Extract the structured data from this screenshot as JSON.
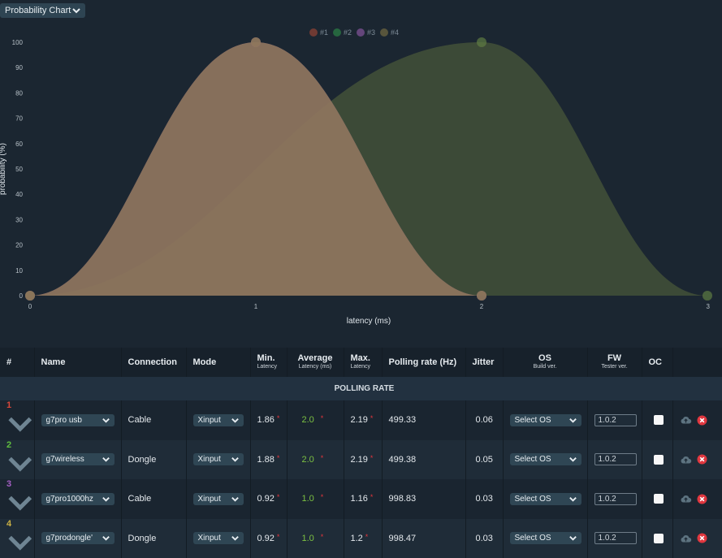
{
  "chart_selector": {
    "label": "Probability Chart",
    "icon": "chevron-down-icon"
  },
  "chart_data": {
    "type": "area",
    "legend": [
      "#1",
      "#2",
      "#3",
      "#4"
    ],
    "legend_position": "top-center",
    "series": [
      {
        "name": "#1",
        "color": "#b54a35",
        "x": [
          0,
          2,
          3
        ],
        "y": [
          0,
          100,
          0
        ]
      },
      {
        "name": "#2",
        "color": "#2f9a4b",
        "x": [
          0,
          2,
          3
        ],
        "y": [
          0,
          100,
          0
        ]
      },
      {
        "name": "#3",
        "color": "#a060b8",
        "x": [
          0,
          1,
          2
        ],
        "y": [
          0,
          100,
          0
        ]
      },
      {
        "name": "#4",
        "color": "#8a7c45",
        "x": [
          0,
          1,
          2
        ],
        "y": [
          0,
          100,
          0
        ]
      }
    ],
    "xlabel": "latency (ms)",
    "ylabel": "probability (%)",
    "xlim": [
      0,
      3
    ],
    "ylim": [
      0,
      100
    ],
    "x_ticks": [
      "0",
      "1",
      "2",
      "3"
    ],
    "y_ticks": [
      "0",
      "10",
      "20",
      "30",
      "40",
      "50",
      "60",
      "70",
      "80",
      "90",
      "100"
    ],
    "grid": false
  },
  "table": {
    "headers": {
      "num": "#",
      "name": "Name",
      "connection": "Connection",
      "mode": "Mode",
      "min": "Min.",
      "min_sub": "Latency",
      "avg": "Average",
      "avg_sub": "Latency (ms)",
      "max": "Max.",
      "max_sub": "Latency",
      "polling": "Polling rate (Hz)",
      "jitter": "Jitter",
      "os": "OS",
      "os_sub": "Build ver.",
      "fw": "FW",
      "fw_sub": "Tester ver.",
      "oc": "OC"
    },
    "section_label": "POLLING RATE",
    "rows": [
      {
        "index": "1",
        "color": "#d9473b",
        "name": "g7pro usb",
        "connection": "Cable",
        "mode": "Xinput",
        "min": "1.86",
        "avg": "2.0",
        "max": "2.19",
        "polling": "499.33",
        "jitter": "0.06",
        "os": "Select OS",
        "fw": "1.0.2"
      },
      {
        "index": "2",
        "color": "#5fbf3f",
        "name": "g7wireless",
        "connection": "Dongle",
        "mode": "Xinput",
        "min": "1.88",
        "avg": "2.0",
        "max": "2.19",
        "polling": "499.38",
        "jitter": "0.05",
        "os": "Select OS",
        "fw": "1.0.2"
      },
      {
        "index": "3",
        "color": "#a55fc4",
        "name": "g7pro1000hz",
        "connection": "Cable",
        "mode": "Xinput",
        "min": "0.92",
        "avg": "1.0",
        "max": "1.16",
        "polling": "998.83",
        "jitter": "0.03",
        "os": "Select OS",
        "fw": "1.0.2"
      },
      {
        "index": "4",
        "color": "#c9b045",
        "name": "g7prodongle'",
        "connection": "Dongle",
        "mode": "Xinput",
        "min": "0.92",
        "avg": "1.0",
        "max": "1.2",
        "polling": "998.47",
        "jitter": "0.03",
        "os": "Select OS",
        "fw": "1.0.2"
      }
    ]
  }
}
